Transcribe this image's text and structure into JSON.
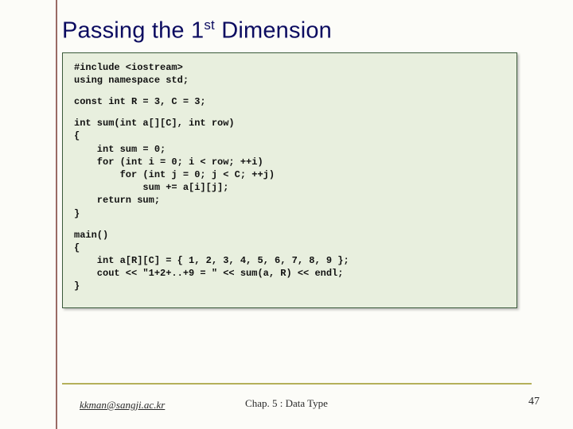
{
  "title_pre": "Passing the 1",
  "title_sup": "st",
  "title_post": " Dimension",
  "code": {
    "block1": "#include <iostream>\nusing namespace std;",
    "block2": "const int R = 3, C = 3;",
    "block3": "int sum(int a[][C], int row)\n{\n    int sum = 0;\n    for (int i = 0; i < row; ++i)\n        for (int j = 0; j < C; ++j)\n            sum += a[i][j];\n    return sum;\n}",
    "block4": "main()\n{\n    int a[R][C] = { 1, 2, 3, 4, 5, 6, 7, 8, 9 };\n    cout << \"1+2+..+9 = \" << sum(a, R) << endl;\n}"
  },
  "footer": {
    "left": "kkman@sangji.ac.kr",
    "center": "Chap. 5 : Data Type",
    "page": "47"
  }
}
